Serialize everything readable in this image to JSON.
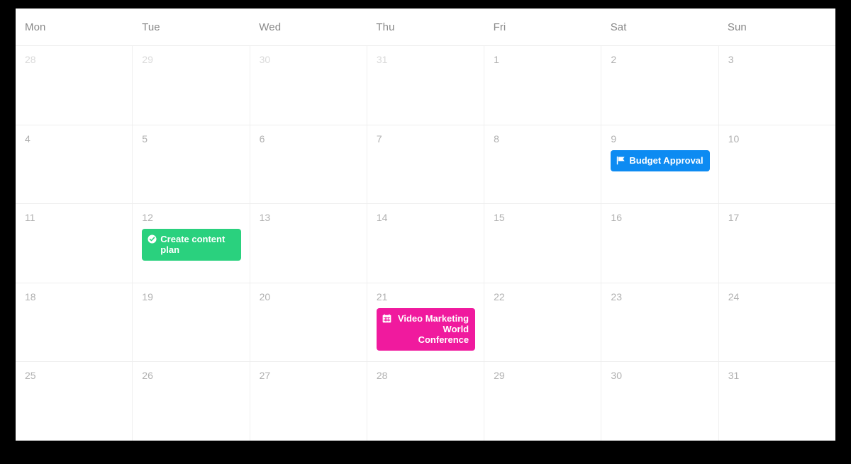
{
  "calendar": {
    "weekday_headers": [
      "Mon",
      "Tue",
      "Wed",
      "Thu",
      "Fri",
      "Sat",
      "Sun"
    ],
    "weeks": [
      {
        "days": [
          {
            "number": "28",
            "other_month": true,
            "events": []
          },
          {
            "number": "29",
            "other_month": true,
            "events": []
          },
          {
            "number": "30",
            "other_month": true,
            "events": []
          },
          {
            "number": "31",
            "other_month": true,
            "events": []
          },
          {
            "number": "1",
            "other_month": false,
            "events": []
          },
          {
            "number": "2",
            "other_month": false,
            "events": []
          },
          {
            "number": "3",
            "other_month": false,
            "events": []
          }
        ]
      },
      {
        "days": [
          {
            "number": "4",
            "other_month": false,
            "events": []
          },
          {
            "number": "5",
            "other_month": false,
            "events": []
          },
          {
            "number": "6",
            "other_month": false,
            "events": []
          },
          {
            "number": "7",
            "other_month": false,
            "events": []
          },
          {
            "number": "8",
            "other_month": false,
            "events": []
          },
          {
            "number": "9",
            "other_month": false,
            "events": [
              {
                "label": "Budget Approval",
                "icon": "flag-icon",
                "color_class": "blue",
                "color": "#0d8bf2"
              }
            ]
          },
          {
            "number": "10",
            "other_month": false,
            "events": []
          }
        ]
      },
      {
        "days": [
          {
            "number": "11",
            "other_month": false,
            "events": []
          },
          {
            "number": "12",
            "other_month": false,
            "events": [
              {
                "label": "Create content plan",
                "icon": "check-circle-icon",
                "color_class": "green",
                "color": "#2ad17e"
              }
            ]
          },
          {
            "number": "13",
            "other_month": false,
            "events": []
          },
          {
            "number": "14",
            "other_month": false,
            "events": []
          },
          {
            "number": "15",
            "other_month": false,
            "events": []
          },
          {
            "number": "16",
            "other_month": false,
            "events": []
          },
          {
            "number": "17",
            "other_month": false,
            "events": []
          }
        ]
      },
      {
        "days": [
          {
            "number": "18",
            "other_month": false,
            "events": []
          },
          {
            "number": "19",
            "other_month": false,
            "events": []
          },
          {
            "number": "20",
            "other_month": false,
            "events": []
          },
          {
            "number": "21",
            "other_month": false,
            "events": [
              {
                "label": "Video Marketing World Conference",
                "icon": "calendar-icon",
                "color_class": "pink",
                "color": "#f01a9e"
              }
            ]
          },
          {
            "number": "22",
            "other_month": false,
            "events": []
          },
          {
            "number": "23",
            "other_month": false,
            "events": []
          },
          {
            "number": "24",
            "other_month": false,
            "events": []
          }
        ]
      },
      {
        "days": [
          {
            "number": "25",
            "other_month": false,
            "events": []
          },
          {
            "number": "26",
            "other_month": false,
            "events": []
          },
          {
            "number": "27",
            "other_month": false,
            "events": []
          },
          {
            "number": "28",
            "other_month": false,
            "events": []
          },
          {
            "number": "29",
            "other_month": false,
            "events": []
          },
          {
            "number": "30",
            "other_month": false,
            "events": []
          },
          {
            "number": "31",
            "other_month": false,
            "events": []
          }
        ]
      }
    ],
    "colors": {
      "page_background": "#000000",
      "surface": "#ffffff",
      "grid_line": "#ededed",
      "weekday_label": "#888888",
      "day_number": "#b0b0b0",
      "day_number_muted": "#dadada"
    }
  }
}
